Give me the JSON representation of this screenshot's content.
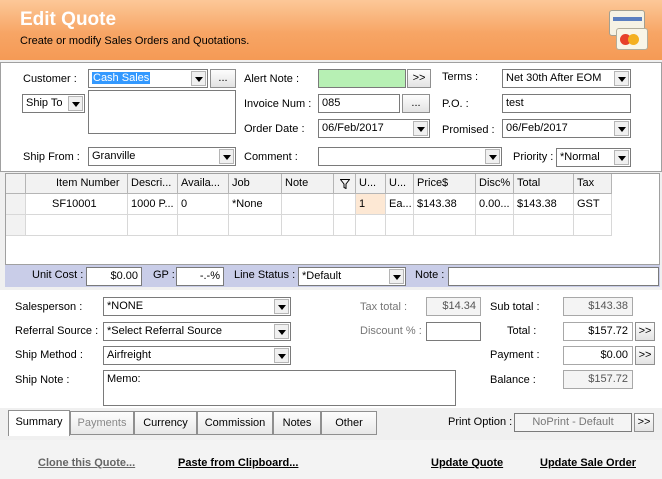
{
  "header": {
    "title": "Edit Quote",
    "subtitle": "Create or modify Sales Orders and Quotations."
  },
  "icons": {
    "header": "cards-and-coins-icon",
    "dropdown": "chevron-down-icon",
    "filter": "filter-icon"
  },
  "colors": {
    "header_orange": "#f7a565",
    "alert_green": "#b7f0b4",
    "selection_blue": "#3399ff",
    "status_bar": "#c9cde8"
  },
  "form": {
    "customer_label": "Customer :",
    "customer_value": "Cash Sales",
    "customer_btn": "...",
    "ship_to_value": "Ship To",
    "ship_from_label": "Ship From :",
    "ship_from_value": "Granville",
    "alert_note_label": "Alert Note :",
    "alert_note_value": "",
    "alert_btn": ">>",
    "invoice_num_label": "Invoice Num :",
    "invoice_num_value": "085",
    "invoice_btn": "...",
    "order_date_label": "Order Date :",
    "order_date_value": "06/Feb/2017",
    "comment_label": "Comment :",
    "comment_value": "",
    "terms_label": "Terms :",
    "terms_value": "Net 30th After EOM",
    "po_label": "P.O. :",
    "po_value": "test",
    "promised_label": "Promised :",
    "promised_value": "06/Feb/2017",
    "priority_label": "Priority :",
    "priority_value": "*Normal"
  },
  "grid": {
    "columns": [
      "Item Number",
      "Descri...",
      "Availa...",
      "Job",
      "Note",
      "",
      "U...",
      "U...",
      "Price$",
      "Disc%",
      "Total",
      "Tax"
    ],
    "rows": [
      [
        "SF10001",
        "1000 P...",
        "0",
        "*None",
        "",
        "",
        "1",
        "Ea...",
        "$143.38",
        "0.00...",
        "$143.38",
        "GST"
      ]
    ]
  },
  "status_bar": {
    "unit_cost_label": "Unit Cost :",
    "unit_cost_value": "$0.00",
    "gp_label": "GP :",
    "gp_value": "-.-%",
    "line_status_label": "Line Status :",
    "line_status_value": "*Default",
    "note_label": "Note :",
    "note_value": ""
  },
  "bottom": {
    "salesperson_label": "Salesperson :",
    "salesperson_value": "*NONE",
    "referral_label": "Referral Source :",
    "referral_value": "*Select Referral Source",
    "ship_method_label": "Ship Method :",
    "ship_method_value": "Airfreight",
    "ship_note_label": "Ship Note :",
    "ship_note_value": "Memo:",
    "tax_total_label": "Tax total :",
    "tax_total_value": "$14.34",
    "discount_label": "Discount % :",
    "discount_value": "",
    "sub_total_label": "Sub total :",
    "sub_total_value": "$143.38",
    "total_label": "Total :",
    "total_value": "$157.72",
    "payment_label": "Payment :",
    "payment_value": "$0.00",
    "balance_label": "Balance :",
    "balance_value": "$157.72",
    "more_btn": ">>"
  },
  "tabs": {
    "items": [
      "Summary",
      "Payments",
      "Currency",
      "Commission",
      "Notes",
      "Other"
    ],
    "print_option_label": "Print Option :",
    "print_option_value": "NoPrint - Default",
    "print_btn": ">>"
  },
  "footer": {
    "clone": "Clone this Quote...",
    "paste": "Paste from Clipboard...",
    "update_quote": "Update Quote",
    "update_order": "Update Sale Order"
  }
}
